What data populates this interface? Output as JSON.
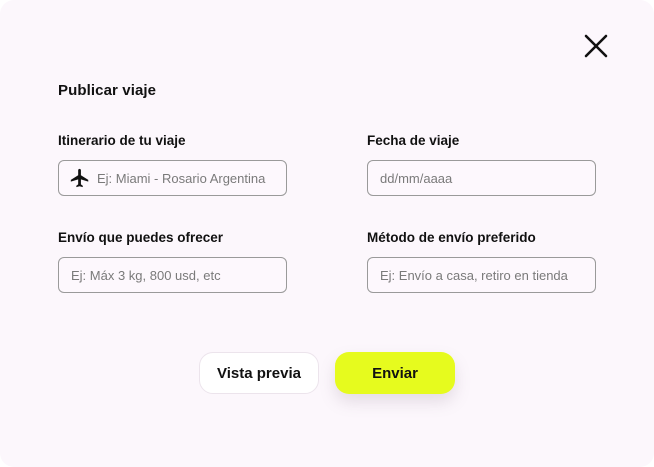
{
  "form": {
    "title": "Publicar viaje",
    "fields": {
      "itinerary": {
        "label": "Itinerario de tu viaje",
        "placeholder": "Ej: Miami - Rosario Argentina",
        "value": ""
      },
      "date": {
        "label": "Fecha de viaje",
        "placeholder": "dd/mm/aaaa",
        "value": ""
      },
      "shipment": {
        "label": "Envío que puedes ofrecer",
        "placeholder": "Ej: Máx 3 kg, 800 usd, etc",
        "value": ""
      },
      "method": {
        "label": "Método de envío preferido",
        "placeholder": "Ej: Envío a casa, retiro en tienda",
        "value": ""
      }
    },
    "buttons": {
      "preview": "Vista previa",
      "send": "Enviar"
    }
  },
  "icons": {
    "close": "close-icon",
    "itinerary": "airplane-icon"
  },
  "colors": {
    "background": "#fcf7fc",
    "accent": "#e6fb1e",
    "text": "#111111",
    "border": "#9a9a9a"
  }
}
